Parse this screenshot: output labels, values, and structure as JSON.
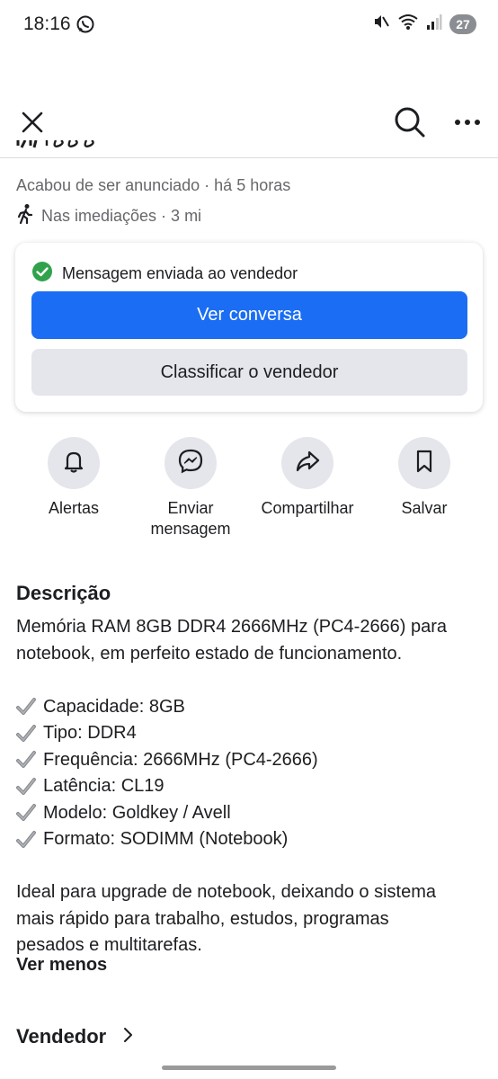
{
  "status_bar": {
    "time": "18:16",
    "battery": "27",
    "icons": [
      "whatsapp-icon",
      "mute-icon",
      "wifi-icon",
      "signal-icon"
    ]
  },
  "nav": {
    "icons": [
      "close-icon",
      "search-icon",
      "more-icon"
    ]
  },
  "listing": {
    "listed": "Acabou de ser anunciado",
    "listed_time": "· há 5 horas",
    "location": "Nas imediações · 3 mi"
  },
  "message_card": {
    "status": "Mensagem enviada ao vendedor",
    "primary_button": "Ver conversa",
    "secondary_button": "Classificar o vendedor",
    "primary_color": "#1b6ef3",
    "success_color": "#31a24c"
  },
  "actions": [
    {
      "label": "Alertas",
      "icon": "bell-icon"
    },
    {
      "label": "Enviar\nmensagem",
      "icon": "messenger-icon"
    },
    {
      "label": "Compartilhar",
      "icon": "share-icon"
    },
    {
      "label": "Salvar",
      "icon": "bookmark-icon"
    }
  ],
  "description": {
    "title": "Descrição",
    "line1": "Memória RAM 8GB DDR4 2666MHz (PC4-2666) para",
    "line2": "notebook, em perfeito estado de funcionamento.",
    "features": [
      "Capacidade: 8GB",
      "Tipo: DDR4",
      "Frequência: 2666MHz (PC4-2666)",
      "Latência: CL19",
      "Modelo: Goldkey / Avell",
      "Formato: SODIMM (Notebook)"
    ],
    "footer1": "Ideal para upgrade de notebook, deixando o sistema",
    "footer2": "mais rápido para trabalho, estudos, programas",
    "footer3": "pesados e multitarefas.",
    "see_less": "Ver menos"
  },
  "seller": {
    "title": "Vendedor"
  }
}
